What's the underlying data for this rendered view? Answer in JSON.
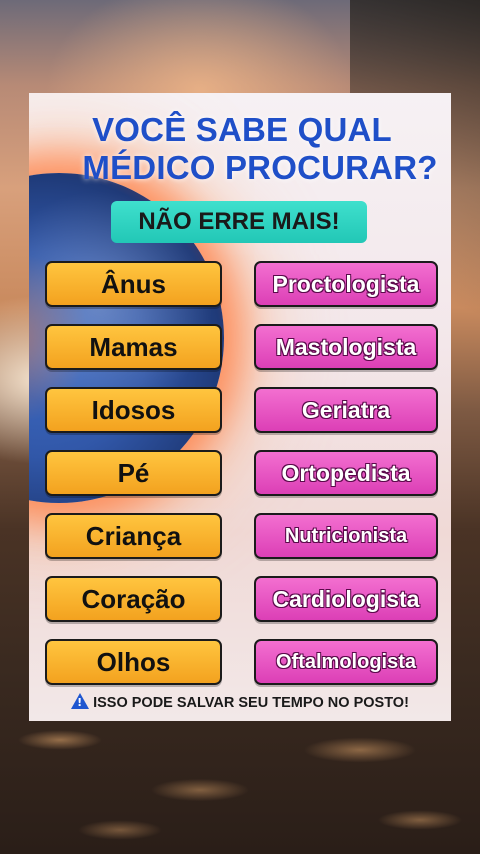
{
  "title": {
    "line1": "VOCÊ SABE QUAL",
    "line2": "MÉDICO PROCURAR?"
  },
  "banner": "NÃO ERRE MAIS!",
  "rows": [
    {
      "part": "Ânus",
      "doctor": "Proctologista"
    },
    {
      "part": "Mamas",
      "doctor": "Mastologista"
    },
    {
      "part": "Idosos",
      "doctor": "Geriatra"
    },
    {
      "part": "Pé",
      "doctor": "Ortopedista"
    },
    {
      "part": "Criança",
      "doctor": "Nutricionista"
    },
    {
      "part": "Coração",
      "doctor": "Cardiologista"
    },
    {
      "part": "Olhos",
      "doctor": "Oftalmologista"
    }
  ],
  "footer": {
    "icon": "warning-icon",
    "text": "ISSO PODE SALVAR SEU TEMPO NO POSTO!"
  },
  "colors": {
    "title": "#1f4fc8",
    "banner": "#2fd3c1",
    "part_button": "#f7b12e",
    "doctor_button": "#e553c3"
  }
}
